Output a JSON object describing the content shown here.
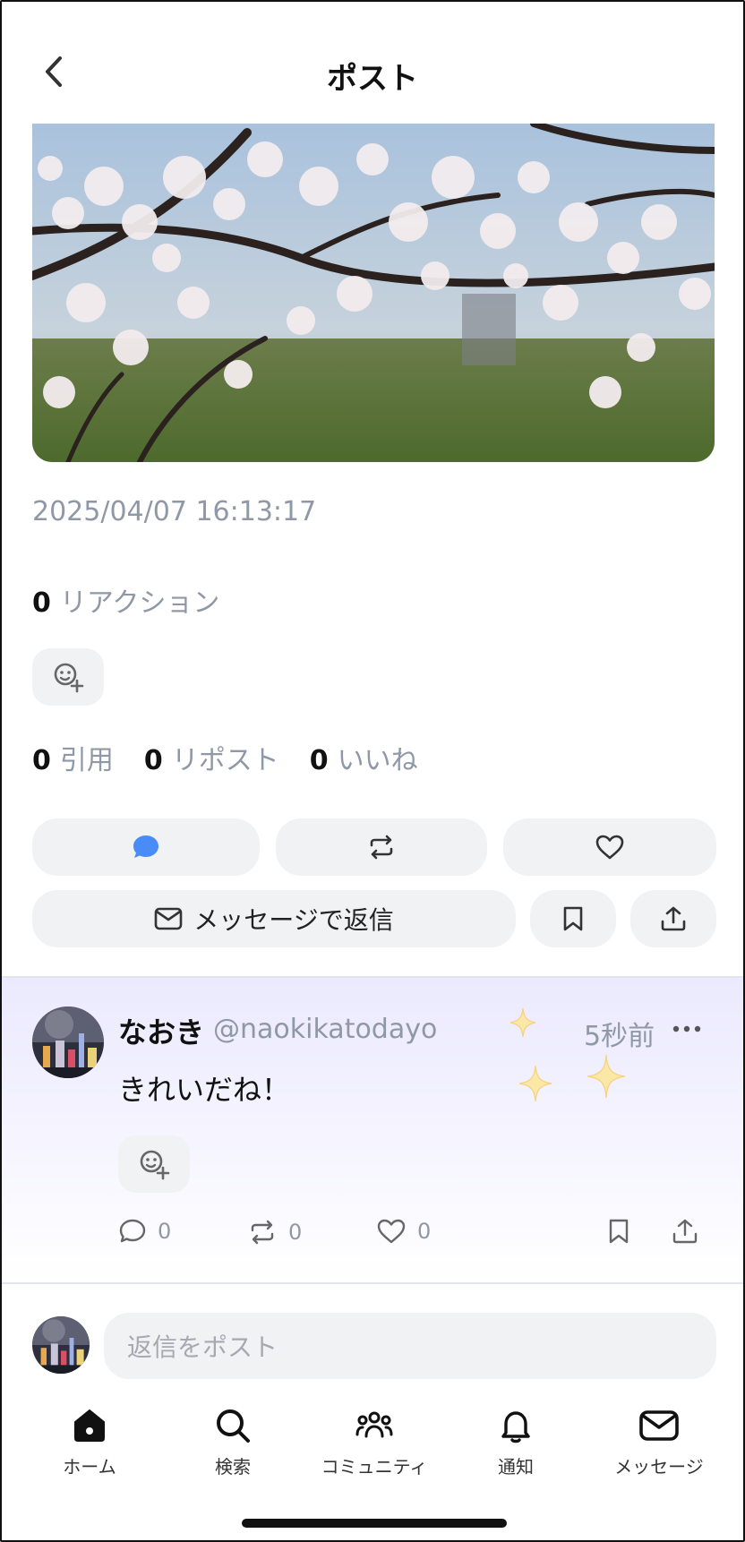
{
  "header": {
    "title": "ポスト"
  },
  "post": {
    "timestamp": "2025/04/07 16:13:17",
    "reactions": {
      "count": "0",
      "label": "リアクション"
    },
    "stats": [
      {
        "count": "0",
        "label": "引用"
      },
      {
        "count": "0",
        "label": "リポスト"
      },
      {
        "count": "0",
        "label": "いいね"
      }
    ],
    "message_reply_label": "メッセージで返信"
  },
  "reply": {
    "name": "なおき",
    "handle": "@naokikatodayo",
    "time": "5秒前",
    "text": "きれいだね！",
    "counts": {
      "comments": "0",
      "reposts": "0",
      "likes": "0"
    }
  },
  "compose": {
    "placeholder": "返信をポスト"
  },
  "tabbar": {
    "items": [
      {
        "label": "ホーム",
        "icon": "home-icon"
      },
      {
        "label": "検索",
        "icon": "search-icon"
      },
      {
        "label": "コミュニティ",
        "icon": "community-icon"
      },
      {
        "label": "通知",
        "icon": "bell-icon"
      },
      {
        "label": "メッセージ",
        "icon": "mail-icon"
      }
    ]
  },
  "colors": {
    "accent": "#4a8cf7",
    "muted": "#8f98a6",
    "pill": "#f1f2f4",
    "reply_bg": "#ebe9fd"
  }
}
